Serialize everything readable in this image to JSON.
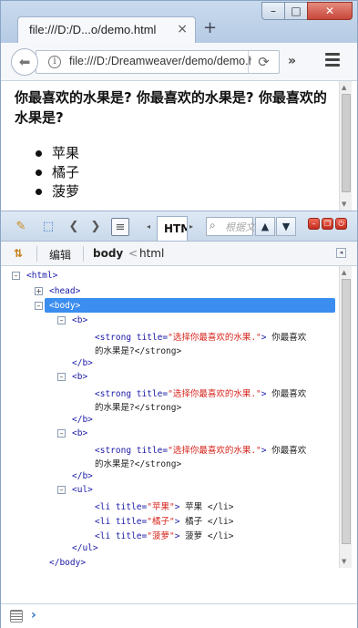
{
  "browser": {
    "tab_title": "file:///D:/D...o/demo.html",
    "tab_close": "×",
    "new_tab": "+",
    "url": "file:///D:/Dreamweaver/demo/demo.html",
    "window_controls": {
      "minimize": "–",
      "maximize": "□",
      "close": "✕"
    }
  },
  "page": {
    "heading": "你最喜欢的水果是? 你最喜欢的水果是? 你最喜欢的水果是?",
    "fruits": [
      "苹果",
      "橘子",
      "菠萝"
    ]
  },
  "devtools": {
    "active_tab": "HTML",
    "search_placeholder": "根据文",
    "subbar": {
      "edit": "编辑",
      "crumb_body": "body",
      "crumb_sep": "<",
      "crumb_html": "html"
    },
    "tree": {
      "html_open": "<html>",
      "head": "<head>",
      "body_open": "<body>",
      "b_open": "<b>",
      "b_close": "</b>",
      "strong_open": "<strong",
      "strong_attr": "title=",
      "strong_val": "\"选择你最喜欢的水果.\"",
      "strong_tail": ">",
      "strong_text_1": "你最喜欢",
      "strong_text_2": "的水果是?</strong>",
      "ul_open": "<ul>",
      "ul_close": "</ul>",
      "li_items": [
        {
          "open": "<li",
          "attr": "title=",
          "val": "\"苹果\"",
          "tail": ">",
          "text": "苹果 </li>"
        },
        {
          "open": "<li",
          "attr": "title=",
          "val": "\"橘子\"",
          "tail": ">",
          "text": "橘子 </li>"
        },
        {
          "open": "<li",
          "attr": "title=",
          "val": "\"菠萝\"",
          "tail": ">",
          "text": "菠萝 </li>"
        }
      ],
      "body_close": "</body>"
    },
    "cmd_prompt": "›"
  }
}
